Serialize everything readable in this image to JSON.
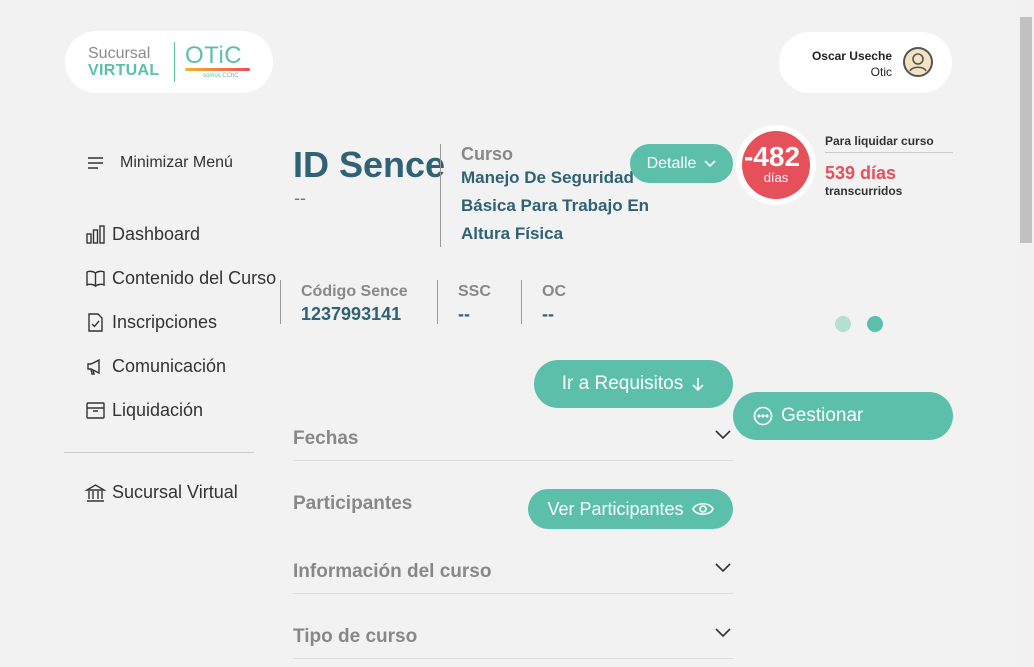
{
  "logo": {
    "line1": "Sucursal",
    "line2": "VIRTUAL",
    "brand": "OTiC",
    "tagline": "somos CChC"
  },
  "user": {
    "name": "Oscar Useche",
    "org": "Otic",
    "icon": "user-avatar-icon"
  },
  "sidebar": {
    "toggle_label": "Minimizar Menú",
    "items": [
      {
        "label": "Dashboard",
        "icon": "bar-chart-icon"
      },
      {
        "label": "Contenido del Curso",
        "icon": "book-icon"
      },
      {
        "label": "Inscripciones",
        "icon": "document-check-icon"
      },
      {
        "label": "Comunicación",
        "icon": "megaphone-icon"
      },
      {
        "label": "Liquidación",
        "icon": "archive-box-icon"
      }
    ],
    "footer_item": {
      "label": "Sucursal Virtual",
      "icon": "bank-icon"
    }
  },
  "course": {
    "id_title": "ID Sence",
    "id_value": "--",
    "curso_label": "Curso",
    "curso_name": "Manejo De Seguridad Básica Para Trabajo En Altura Física",
    "detalle_button": "Detalle",
    "codes": [
      {
        "label": "Código Sence",
        "value": "1237993141"
      },
      {
        "label": "SSC",
        "value": "--"
      },
      {
        "label": "OC",
        "value": "--"
      }
    ]
  },
  "countdown": {
    "days": "-482",
    "days_word": "días",
    "label": "Para liquidar curso",
    "elapsed": "539 días",
    "elapsed_word": "transcurridos"
  },
  "actions": {
    "requisitos_button": "Ir a Requisitos",
    "gestionar_button": "Gestionar",
    "participantes_button": "Ver Participantes"
  },
  "sections": {
    "fechas": "Fechas",
    "participantes": "Participantes",
    "informacion": "Información del curso",
    "tipo": "Tipo de curso"
  },
  "colors": {
    "accent": "#5bbfaa",
    "title": "#2f6275",
    "alert": "#e5505a"
  },
  "carousel": {
    "active_index": 1,
    "count": 2
  }
}
